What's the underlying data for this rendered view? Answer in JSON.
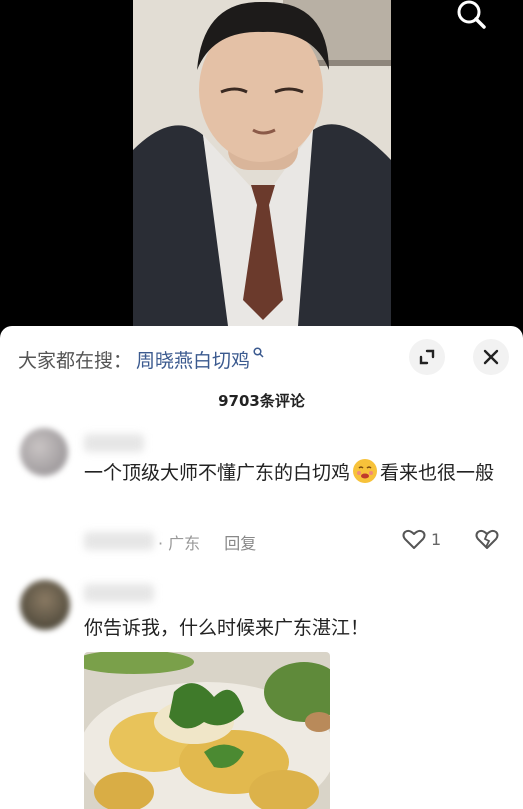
{
  "video": {
    "search_icon": "search-icon"
  },
  "sheet": {
    "search_prefix": "大家都在搜：",
    "search_term": "周晓燕白切鸡",
    "expand_icon": "expand-icon",
    "close_icon": "close-icon",
    "comment_count": "9703条评论"
  },
  "comments": [
    {
      "text_a": "一个顶级大师不懂广东的白切鸡",
      "emoji": "grimace-emoji",
      "text_b": "看来也很一般",
      "location": "· 广东",
      "reply": "回复",
      "likes": "1"
    },
    {
      "text": "你告诉我，什么时候来广东湛江！"
    }
  ],
  "colors": {
    "link": "#3b5a8f",
    "meta": "#999999"
  }
}
